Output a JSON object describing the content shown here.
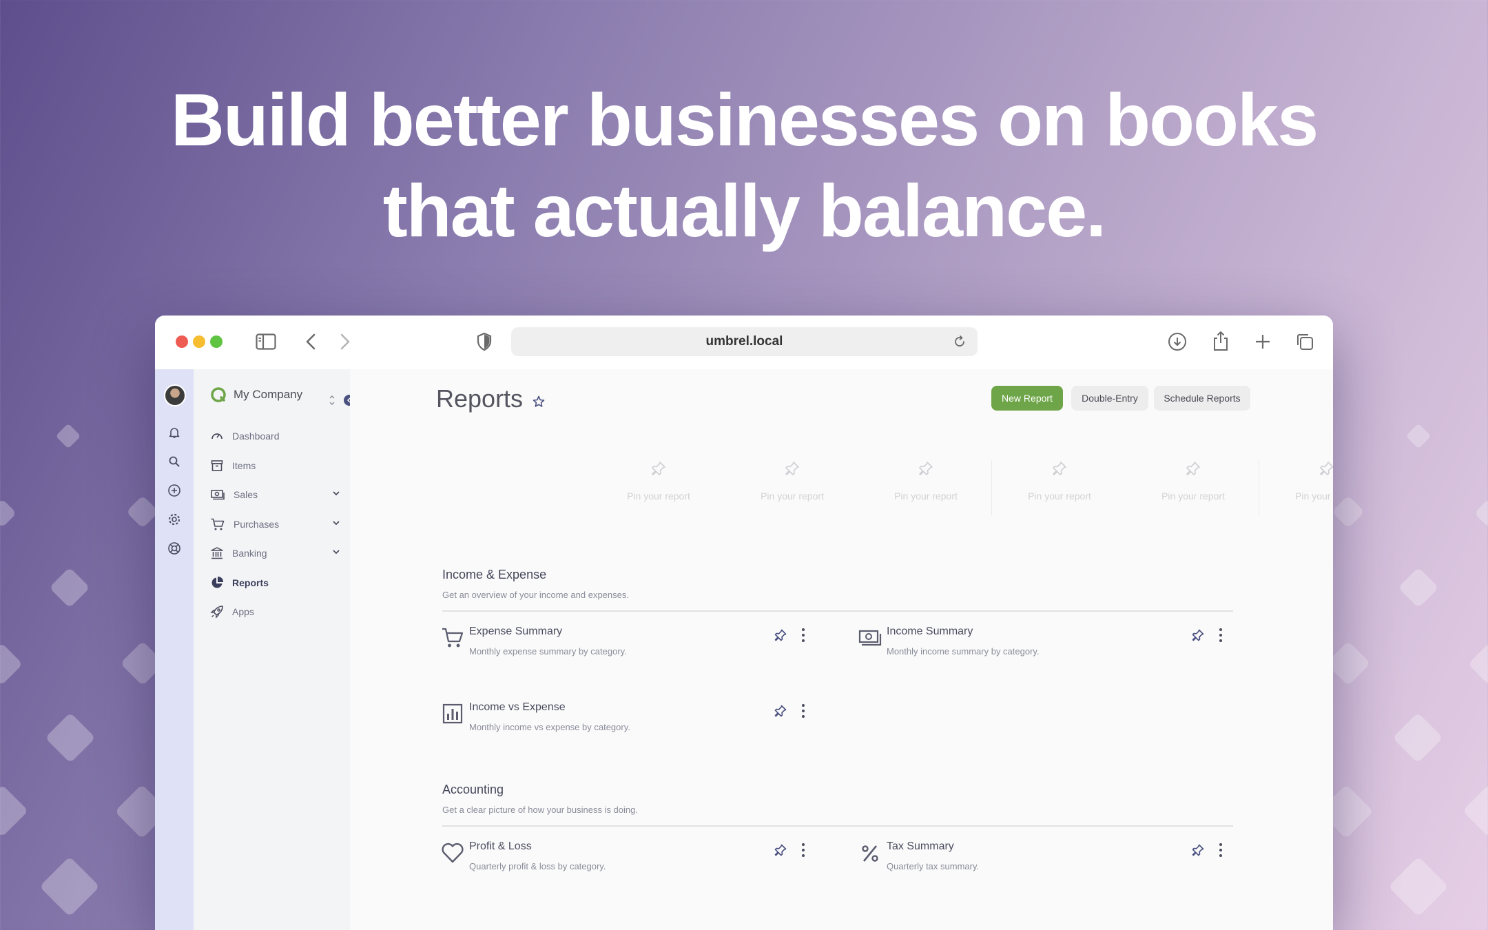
{
  "hero": {
    "line1": "Build better businesses on books",
    "line2": "that actually balance."
  },
  "browser": {
    "url": "umbrel.local"
  },
  "sidebar": {
    "company": "My Company",
    "items": [
      {
        "label": "Dashboard",
        "icon": "gauge-icon"
      },
      {
        "label": "Items",
        "icon": "archive-icon"
      },
      {
        "label": "Sales",
        "icon": "money-icon",
        "expandable": true
      },
      {
        "label": "Purchases",
        "icon": "cart-icon",
        "expandable": true
      },
      {
        "label": "Banking",
        "icon": "bank-icon",
        "expandable": true
      },
      {
        "label": "Reports",
        "icon": "pie-icon",
        "active": true
      },
      {
        "label": "Apps",
        "icon": "rocket-icon"
      }
    ]
  },
  "header": {
    "title": "Reports",
    "buttons": {
      "new_report": "New Report",
      "double_entry": "Double-Entry",
      "schedule_reports": "Schedule Reports"
    }
  },
  "pins": [
    "Pin your report",
    "Pin your report",
    "Pin your report",
    "Pin your report",
    "Pin your report",
    "Pin your report"
  ],
  "sections": [
    {
      "title": "Income & Expense",
      "description": "Get an overview of your income and expenses.",
      "reports": [
        {
          "title": "Expense Summary",
          "description": "Monthly expense summary by category.",
          "icon": "cart-icon"
        },
        {
          "title": "Income Summary",
          "description": "Monthly income summary by category.",
          "icon": "money-icon"
        },
        {
          "title": "Income vs Expense",
          "description": "Monthly income vs expense by category.",
          "icon": "bar-chart-icon"
        }
      ]
    },
    {
      "title": "Accounting",
      "description": "Get a clear picture of how your business is doing.",
      "reports": [
        {
          "title": "Profit & Loss",
          "description": "Quarterly profit & loss by category.",
          "icon": "heart-icon"
        },
        {
          "title": "Tax Summary",
          "description": "Quarterly tax summary.",
          "icon": "percent-icon"
        }
      ]
    }
  ],
  "colors": {
    "accent_green": "#6ea548",
    "rail": "#dfe1f7",
    "traffic_red": "#ee5b52",
    "traffic_yellow": "#f5bd2f",
    "traffic_green": "#5ec441"
  }
}
